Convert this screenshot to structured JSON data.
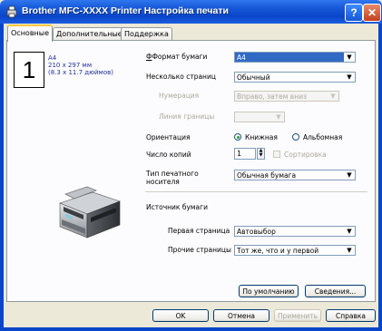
{
  "window": {
    "title": "Brother MFC-XXXX Printer Настройка печати",
    "help": "?",
    "close": "✕"
  },
  "tabs": [
    {
      "label": "Основные"
    },
    {
      "label": "Дополнительные"
    },
    {
      "label": "Поддержка"
    }
  ],
  "preview": {
    "number": "1",
    "paper": "A4",
    "size_mm": "210 x 297 мм",
    "size_in": "(8.3 x 11.7 дюймов)"
  },
  "settings": {
    "paper_format": {
      "label": "Формат бумаги",
      "value": "A4"
    },
    "multiple_pages": {
      "label": "Несколько страниц",
      "value": "Обычный"
    },
    "numbering": {
      "label": "Нумерация",
      "value": "Вправо, затем вниз"
    },
    "page_border": {
      "label": "Линия границы",
      "value": ""
    },
    "orientation": {
      "label": "Ориентация",
      "portrait": "Книжная",
      "landscape": "Альбомная"
    },
    "copies": {
      "label": "Число копий",
      "value": "1",
      "collate": "Сортировка"
    },
    "media_type": {
      "label": "Тип печатного носителя",
      "value": "Обычная бумага"
    }
  },
  "paper_source": {
    "heading": "Источник бумаги",
    "first_page": {
      "label": "Первая страница",
      "value": "Автовыбор"
    },
    "other_pages": {
      "label": "Прочие страницы",
      "value": "Тот же, что и у первой"
    }
  },
  "panel_buttons": {
    "defaults": "По умолчанию",
    "about": "Сведения..."
  },
  "dialog_buttons": {
    "ok": "OK",
    "cancel": "Отмена",
    "apply": "Применить",
    "help": "Справка"
  }
}
